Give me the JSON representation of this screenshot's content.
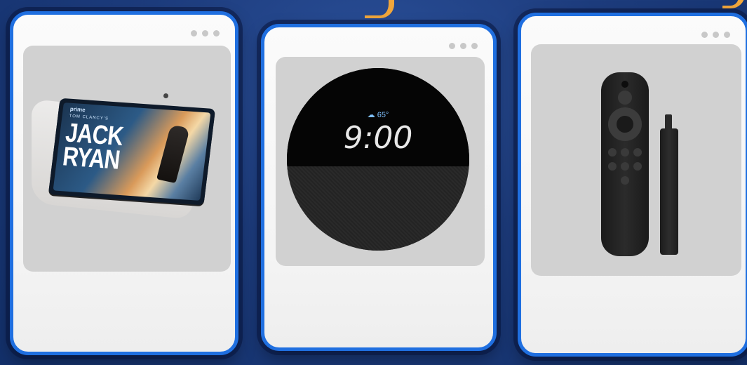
{
  "page": {
    "background_color": "#1d3c7d",
    "accent_color": "#1f6fe0",
    "ribbon_color": "#f0a63b"
  },
  "cards": [
    {
      "product": "echo-show",
      "window_dots": 3,
      "screen": {
        "brand": "prime",
        "subtitle": "TOM CLANCY'S",
        "title_line_1": "JACK",
        "title_line_2": "RYAN"
      }
    },
    {
      "product": "echo-spot",
      "window_dots": 3,
      "screen": {
        "weather": "☁ 65°",
        "time": "9:00"
      }
    },
    {
      "product": "fire-tv-stick",
      "window_dots": 3
    }
  ]
}
